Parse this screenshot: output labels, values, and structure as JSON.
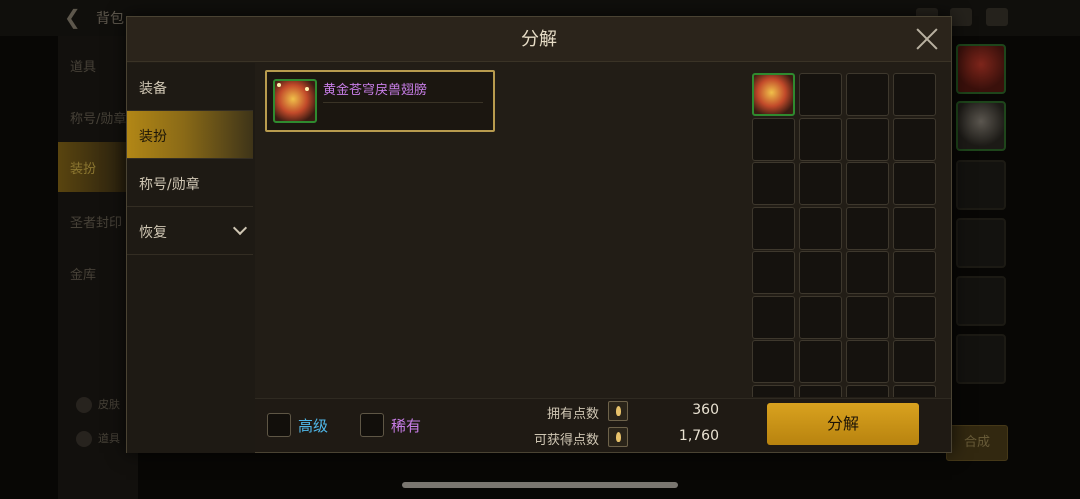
{
  "background": {
    "title": "背包",
    "sidebar_items": [
      "道具",
      "称号/勋章",
      "装扮",
      "圣者封印",
      "金库"
    ],
    "bottom_items": [
      "皮肤",
      "道具"
    ],
    "merge_label": "合成"
  },
  "modal": {
    "title": "分解",
    "menu": [
      {
        "label": "装备"
      },
      {
        "label": "装扮"
      },
      {
        "label": "称号/勋章"
      },
      {
        "label": "恢复"
      }
    ],
    "selected_item": {
      "name": "黄金苍穹戾兽翅膀"
    },
    "filters": {
      "high_label": "高级",
      "rare_label": "稀有"
    },
    "points": {
      "owned_label": "拥有点数",
      "owned_value": "360",
      "gain_label": "可获得点数",
      "gain_value": "1,760"
    },
    "decompose_button": "分解"
  },
  "colors": {
    "accent_gold": "#d9a21f",
    "rare_purple": "#c77de6",
    "high_blue": "#4fb7e8",
    "item_border_green": "#2f8a2f"
  }
}
